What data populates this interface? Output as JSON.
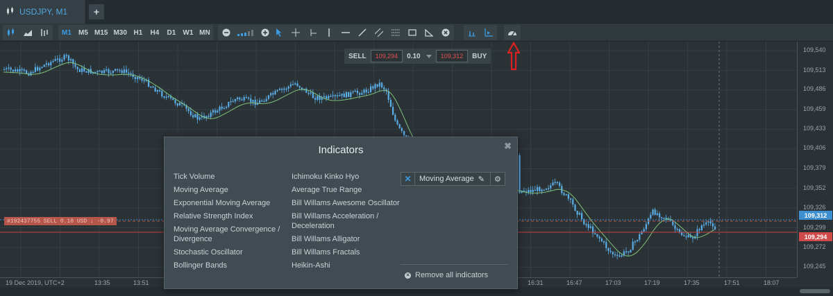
{
  "tab": {
    "label": "USDJPY, M1"
  },
  "toolbar": {
    "timeframes": [
      "M1",
      "M5",
      "M15",
      "M30",
      "H1",
      "H4",
      "D1",
      "W1",
      "MN"
    ],
    "active_timeframe": "M1"
  },
  "trade": {
    "sell_label": "SELL",
    "sell_price": "109,294",
    "quantity": "0.10",
    "buy_price": "109,312",
    "buy_label": "BUY"
  },
  "position_label": "#192437755 SELL 0.10 USD ↓ -0.97",
  "price_axis": {
    "ticks": [
      "109,540",
      "109,513",
      "109,486",
      "109,459",
      "109,433",
      "109,406",
      "109,379",
      "109,352",
      "109,326",
      "109,299",
      "109,272",
      "109,245"
    ],
    "buy_tag": "109,312",
    "sell_tag": "109,294"
  },
  "time_axis": {
    "ticks": [
      "19 Dec 2019, UTC+2",
      "13:35",
      "13:51",
      "16:31",
      "16:47",
      "17:03",
      "17:19",
      "17:35",
      "17:51",
      "18:07"
    ]
  },
  "dialog": {
    "title": "Indicators",
    "col1": [
      "Tick Volume",
      "Moving Average",
      "Exponential Moving Average",
      "Relative Strength Index",
      "Moving Average Convergence / Divergence",
      "Stochastic Oscillator",
      "Bollinger Bands"
    ],
    "col2": [
      "Ichimoku Kinko Hyo",
      "Average True Range",
      "Bill Willams Awesome Oscillator",
      "Bill Willams Acceleration / Deceleration",
      "Bill Willams Alligator",
      "Bill Willams Fractals",
      "Heikin-Ashi"
    ],
    "active_indicator": "Moving Average",
    "remove_all": "Remove all indicators"
  },
  "colors": {
    "accent": "#3d9be0",
    "sell": "#e05050",
    "ma_line": "#7fc27a",
    "candle": "#5aaee8"
  }
}
